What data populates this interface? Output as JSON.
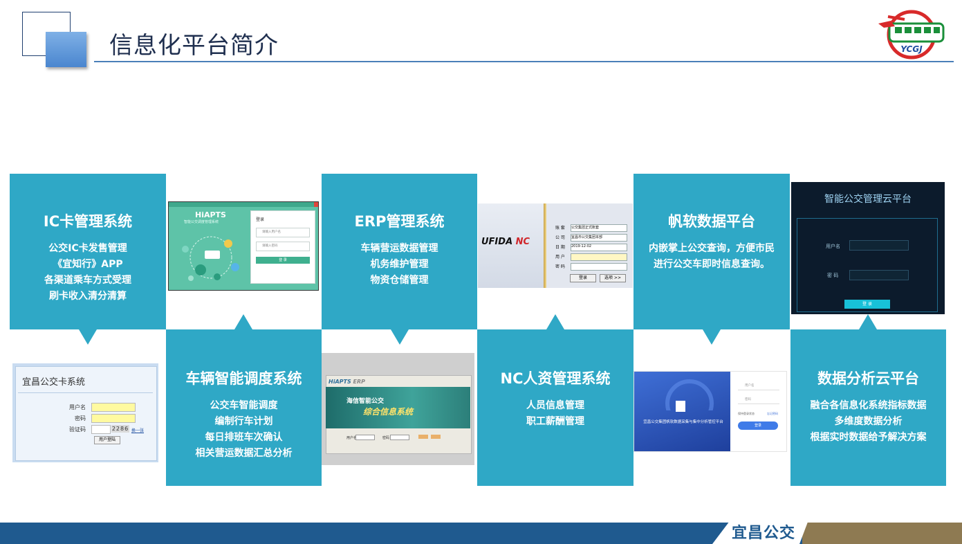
{
  "header": {
    "title": "信息化平台简介"
  },
  "logo": {
    "text": "YCGJ"
  },
  "tiles": [
    {
      "title": "IC卡管理系统",
      "lines": [
        "公交IC卡发售管理",
        "《宜知行》APP",
        "各渠道乘车方式受理",
        "刷卡收入清分清算"
      ]
    },
    {
      "title": "车辆智能调度系统",
      "lines": [
        "公交车智能调度",
        "编制行车计划",
        "每日排班车次确认",
        "相关营运数据汇总分析"
      ]
    },
    {
      "title": "ERP管理系统",
      "lines": [
        "车辆营运数据管理",
        "机务维护管理",
        "物资仓储管理"
      ]
    },
    {
      "title": "NC人资管理系统",
      "lines": [
        "人员信息管理",
        "职工薪酬管理"
      ]
    },
    {
      "title": "帆软数据平台",
      "lines": [
        "内嵌掌上公交查询，方便市民",
        "进行公交车即时信息查询。"
      ]
    },
    {
      "title": "数据分析云平台",
      "lines": [
        "融合各信息化系统指标数据",
        "多维度数据分析",
        "根据实时数据给予解决方案"
      ]
    }
  ],
  "shots": {
    "hiapts": {
      "brand": "HiAPTS",
      "sub": "智能公交调度管理系统",
      "login": "登录",
      "user_ph": "请输入用户名",
      "pwd_ph": "请输入密码",
      "btn": "登 录"
    },
    "ufida": {
      "brand": "UFIDA",
      "brand_nc": "NC",
      "rows": [
        {
          "label": "账 套",
          "value": "公交集团正式账套"
        },
        {
          "label": "公 司",
          "value": "宜昌市公交集团本部"
        },
        {
          "label": "日 期",
          "value": "2019-12-02"
        },
        {
          "label": "用 户",
          "value": ""
        },
        {
          "label": "密 码",
          "value": ""
        }
      ],
      "login": "登录",
      "options": "选项 >>"
    },
    "cloud": {
      "title": "智能公交管理云平台",
      "user": "用户名",
      "pwd": "密 码",
      "btn": "登 录"
    },
    "iccard": {
      "title": "宜昌公交卡系统",
      "user": "用户名",
      "pwd": "密码",
      "code": "验证码",
      "code_val": "2286",
      "refresh": "换一张",
      "btn": "用户登陆"
    },
    "erp": {
      "brand": "HiAPTS",
      "brand2": "ERP",
      "banner1": "海信智能公交",
      "banner2": "综合信息系统",
      "user": "用户名",
      "pwd": "密码"
    },
    "fanruan": {
      "caption": "宜昌公交集团帆软数据采集与集中分析管控平台",
      "user": "用户名",
      "pwd": "密码",
      "remember": "保持登录状态",
      "forgot": "忘记密码",
      "btn": "登录"
    }
  },
  "footer": {
    "brand": "宜昌公交"
  }
}
